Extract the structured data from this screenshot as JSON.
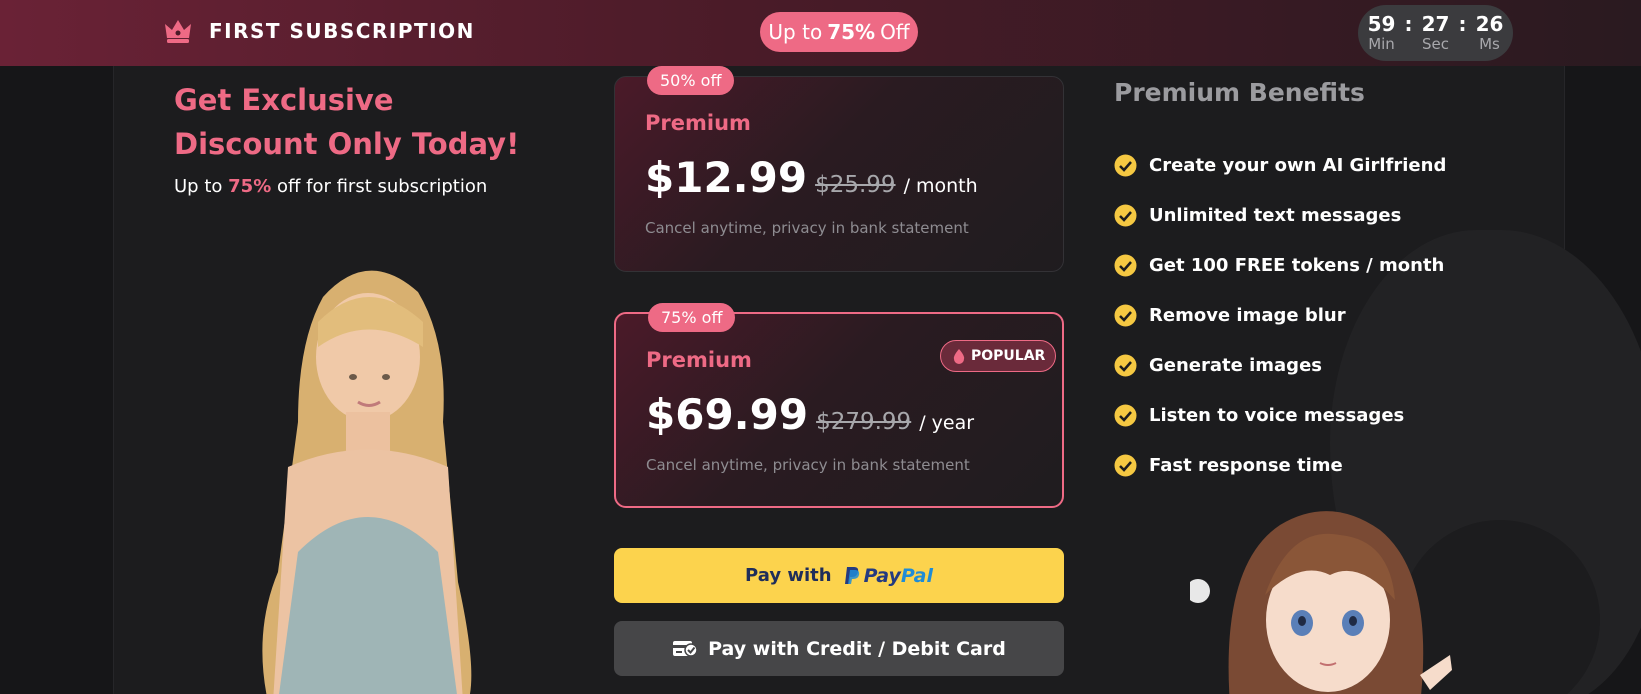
{
  "topbar": {
    "brand": "FIRST SUBSCRIPTION",
    "offer_prefix": "Up to",
    "offer_value": "75%",
    "offer_suffix": "Off",
    "timer": [
      {
        "value": "59",
        "label": "Min"
      },
      {
        "value": "27",
        "label": "Sec"
      },
      {
        "value": "26",
        "label": "Ms"
      }
    ],
    "timer_separator": ":"
  },
  "promo": {
    "headline_line1": "Get Exclusive",
    "headline_line2": "Discount Only Today!",
    "sub_prefix": "Up to",
    "sub_value": "75%",
    "sub_suffix": "off for first subscription"
  },
  "plans": [
    {
      "badge": "50% off",
      "name": "Premium",
      "price": "$12.99",
      "old_price": "$25.99",
      "period": "/ month",
      "note": "Cancel anytime, privacy in bank statement",
      "selected": false
    },
    {
      "badge": "75% off",
      "name": "Premium",
      "price": "$69.99",
      "old_price": "$279.99",
      "period": "/ year",
      "note": "Cancel anytime, privacy in bank statement",
      "popular_label": "POPULAR",
      "selected": true
    }
  ],
  "payment": {
    "paypal_prefix": "Pay with",
    "paypal_logo_part1": "Pay",
    "paypal_logo_part2": "Pal",
    "card_label": "Pay with Credit / Debit Card"
  },
  "benefits": {
    "title": "Premium Benefits",
    "items": [
      "Create your own AI Girlfriend",
      "Unlimited text messages",
      "Get 100 FREE tokens / month",
      "Remove image blur",
      "Generate images",
      "Listen to voice messages",
      "Fast response time"
    ]
  },
  "colors": {
    "accent": "#ee6a85",
    "paypal_button": "#fcd34d",
    "card_button": "#464648",
    "check": "#f5c842",
    "background": "#161618"
  },
  "icons": [
    "crown-icon",
    "drop-icon",
    "check-icon",
    "paypal-icon",
    "card-check-icon"
  ]
}
